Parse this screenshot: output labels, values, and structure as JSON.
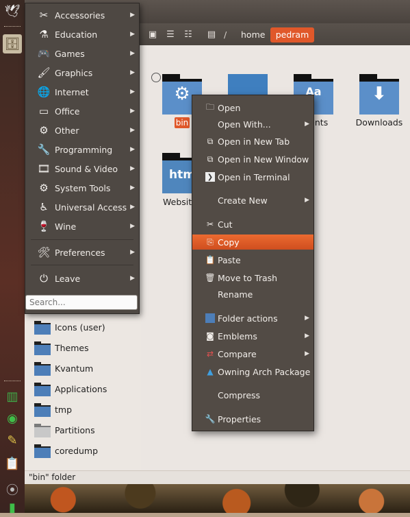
{
  "app_menu": {
    "items": [
      {
        "label": "Accessories",
        "icon": "accessories-icon"
      },
      {
        "label": "Education",
        "icon": "education-icon"
      },
      {
        "label": "Games",
        "icon": "games-icon"
      },
      {
        "label": "Graphics",
        "icon": "graphics-icon"
      },
      {
        "label": "Internet",
        "icon": "internet-icon"
      },
      {
        "label": "Office",
        "icon": "office-icon"
      },
      {
        "label": "Other",
        "icon": "other-icon"
      },
      {
        "label": "Programming",
        "icon": "programming-icon"
      },
      {
        "label": "Sound & Video",
        "icon": "sound-video-icon"
      },
      {
        "label": "System Tools",
        "icon": "system-tools-icon"
      },
      {
        "label": "Universal Access",
        "icon": "universal-access-icon"
      },
      {
        "label": "Wine",
        "icon": "wine-icon"
      }
    ],
    "preferences": "Preferences",
    "leave": "Leave",
    "search_placeholder": "Search..."
  },
  "toolbar": {
    "crumb_sep": "/",
    "crumb_home": "home",
    "crumb_user": "pedram"
  },
  "sidebar": {
    "items": [
      {
        "label": "Icons (user)"
      },
      {
        "label": "Themes"
      },
      {
        "label": "Kvantum"
      },
      {
        "label": "Applications"
      },
      {
        "label": "tmp"
      },
      {
        "label": "Partitions"
      },
      {
        "label": "coredump"
      }
    ]
  },
  "content": {
    "items": [
      {
        "label": "bin",
        "glyph": "⚙"
      },
      {
        "label": "",
        "glyph": ""
      },
      {
        "label": "ments",
        "glyph": "Aa"
      },
      {
        "label": "Downloads",
        "glyph": "⬇"
      },
      {
        "label": "Websit",
        "glyph": "htm"
      }
    ]
  },
  "context_menu": {
    "items": [
      {
        "label": "Open",
        "icon": "folder-open-icon"
      },
      {
        "label": "Open With...",
        "icon": ""
      },
      {
        "label": "Open in New Tab",
        "icon": "new-tab-icon"
      },
      {
        "label": "Open in New Window",
        "icon": "new-window-icon"
      },
      {
        "label": "Open in Terminal",
        "icon": "terminal-icon"
      },
      {
        "label": "Create New",
        "icon": ""
      },
      {
        "label": "Cut",
        "icon": "scissors-icon"
      },
      {
        "label": "Copy",
        "icon": "copy-icon"
      },
      {
        "label": "Paste",
        "icon": "paste-icon"
      },
      {
        "label": "Move to Trash",
        "icon": "trash-icon"
      },
      {
        "label": "Rename",
        "icon": ""
      },
      {
        "label": "Folder actions",
        "icon": "folder-icon"
      },
      {
        "label": "Emblems",
        "icon": "emblem-icon"
      },
      {
        "label": "Compare",
        "icon": "compare-icon"
      },
      {
        "label": "Owning Arch Package",
        "icon": "arch-icon"
      },
      {
        "label": "Compress",
        "icon": ""
      },
      {
        "label": "Properties",
        "icon": "wrench-icon"
      }
    ]
  },
  "statusbar": {
    "text": "\"bin\" folder"
  },
  "colors": {
    "accent": "#e0582a",
    "menu_bg": "#4e4843",
    "folder_blue": "#5b8fc9"
  }
}
